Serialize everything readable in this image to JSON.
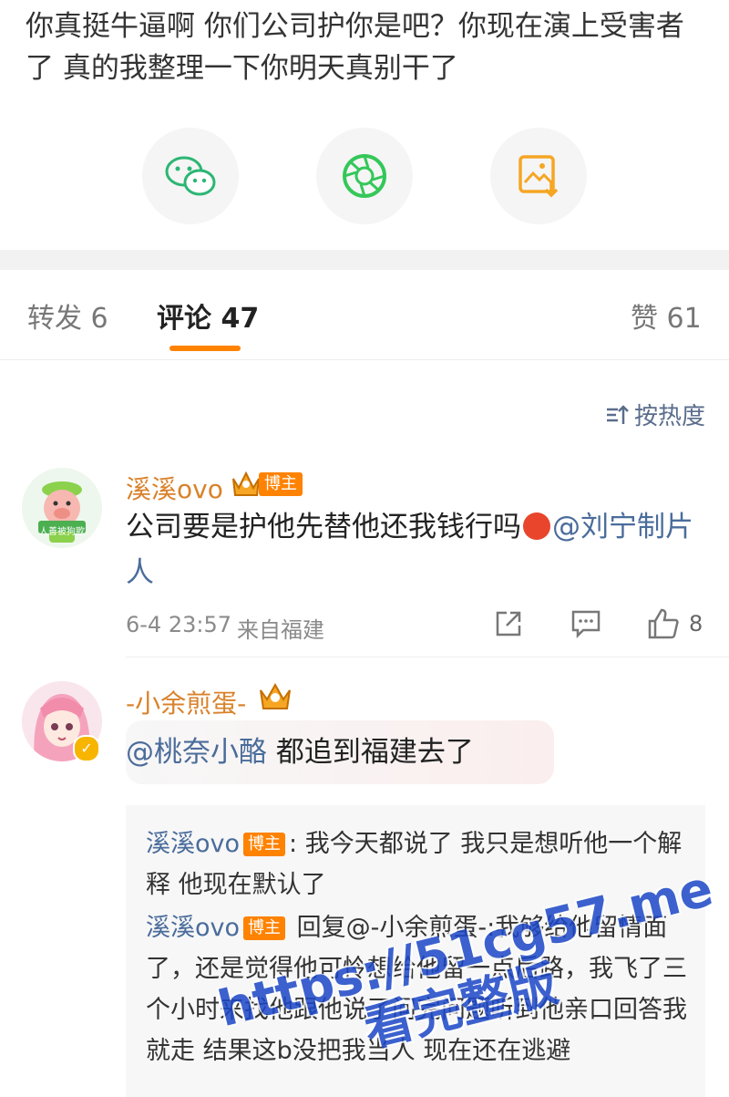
{
  "post": {
    "text": "你真挺牛逼啊 你们公司护你是吧？你现在演上受害者了 真的我整理一下你明天真别干了"
  },
  "share": [
    {
      "icon": "wechat-icon"
    },
    {
      "icon": "moments-icon"
    },
    {
      "icon": "save-image-icon"
    }
  ],
  "tabs": {
    "repost": "转发 6",
    "comments": "评论 47",
    "likes": "赞 61"
  },
  "sort_label": "按热度",
  "colors": {
    "accent": "#ff8200",
    "username": "#d9822b",
    "link": "#4a6c9b"
  },
  "comments": [
    {
      "username": "溪溪ovo",
      "host_badge": "博主",
      "avatar_caption": "人善被狗欺",
      "text": "公司要是护他先替他还我钱行吗",
      "mention": "@刘宁制片人",
      "time": "6-4 23:57",
      "location": "来自福建",
      "likes": "8"
    },
    {
      "username": "-小余煎蛋-",
      "mention": "@桃奈小酪",
      "text": " 都追到福建去了",
      "replies": [
        {
          "user": "溪溪ovo",
          "badge": "博主",
          "text": ": 我今天都说了 我只是想听他一个解释 他现在默认了"
        },
        {
          "user": "溪溪ovo",
          "badge": "博主",
          "text": " 回复@-小余煎蛋-:我够给他留情面了，还是觉得他可怜想给他留一点后路，我飞了三个小时来找他跟他说了问完问题听到他亲口回答我就走 结果这b没把我当人 现在还在逃避"
        }
      ]
    }
  ],
  "watermark": {
    "line1": "https://51cg57.me",
    "line2": "看完整版"
  }
}
